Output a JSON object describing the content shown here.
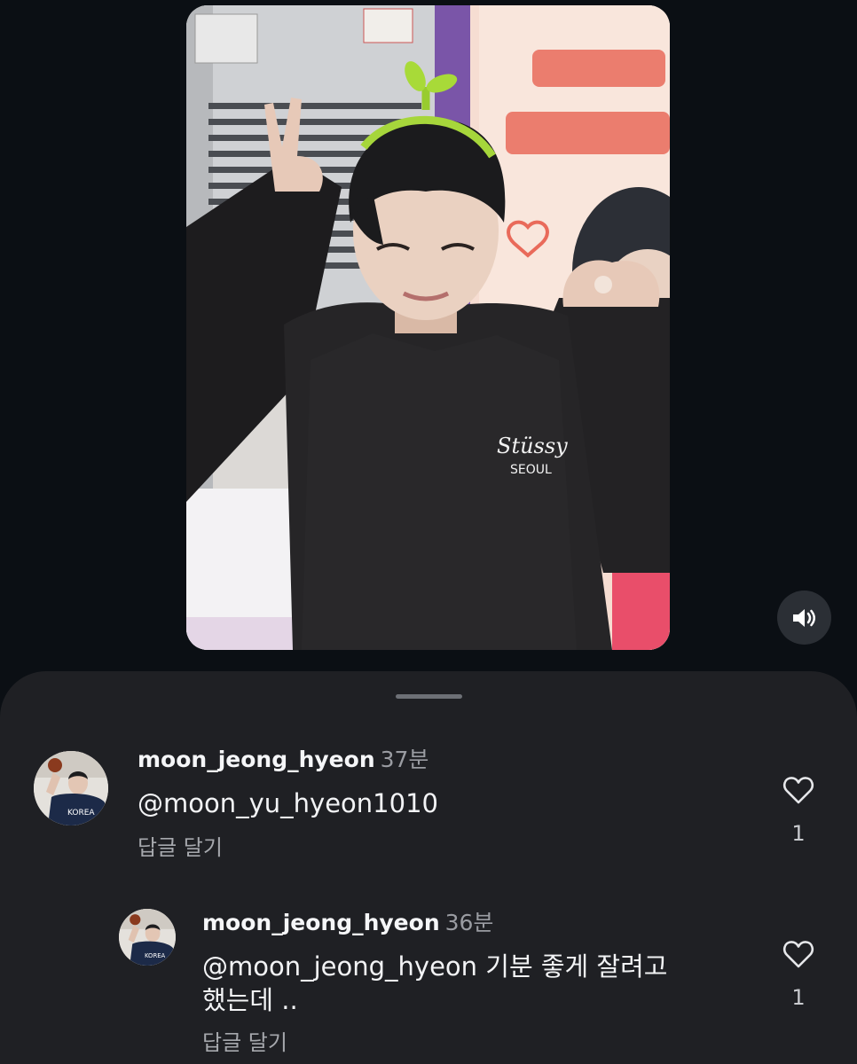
{
  "video": {
    "sound_icon": "speaker-volume-icon"
  },
  "comments": [
    {
      "username": "moon_jeong_hyeon",
      "time": "37분",
      "mention_symbol": "@",
      "text": "moon_yu_hyeon1010",
      "reply_label": "답글 달기",
      "like_icon": "heart-icon",
      "like_count": "1"
    },
    {
      "username": "moon_jeong_hyeon",
      "time": "36분",
      "mention_symbol": "@",
      "text_line1": "moon_jeong_hyeon 기분 좋게 잘려고",
      "text_line2": "했는데 ..",
      "reply_label": "답글 달기",
      "like_icon": "heart-icon",
      "like_count": "1"
    }
  ]
}
